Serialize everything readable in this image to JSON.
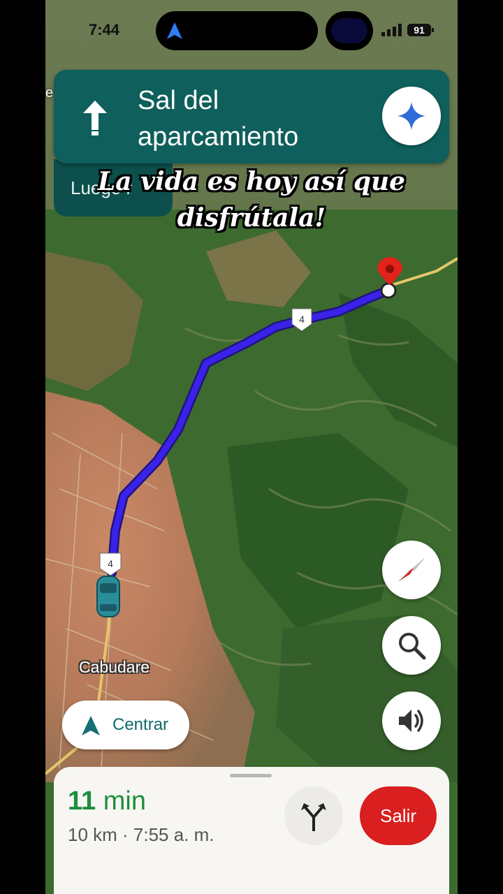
{
  "status_bar": {
    "time": "7:44",
    "battery": "91",
    "island_icon": "navigation-arrow-icon"
  },
  "navigation": {
    "instruction": "Sal del aparcamiento",
    "direction_icon": "straight-arrow-icon",
    "next_step": "Luego r",
    "assistant_icon": "gemini-sparkle-icon"
  },
  "overlay_caption": {
    "text": "La vida es hoy así que disfrútala!"
  },
  "map": {
    "route_badge": "4",
    "route_badge_2": "4",
    "place_label": "Cabudare",
    "edge_label": "e",
    "route_color": "#3a22e8"
  },
  "controls": {
    "compass_icon": "compass-icon",
    "search_icon": "search-icon",
    "sound_icon": "volume-icon",
    "center_label": "Centrar"
  },
  "trip": {
    "duration_value": "11",
    "duration_unit": "min",
    "details": "10 km · 7:55 a. m.",
    "routes_icon": "alternate-routes-icon",
    "exit_label": "Salir"
  },
  "colors": {
    "header": "#0f5f5c",
    "eta": "#1e8e3e",
    "exit": "#d91f1f"
  }
}
